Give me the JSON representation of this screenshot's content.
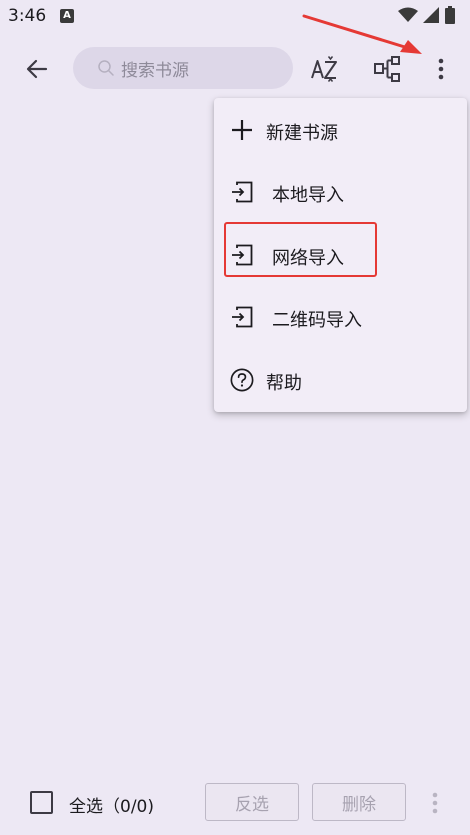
{
  "status_bar": {
    "time": "3:46",
    "notification_badge": "A"
  },
  "toolbar": {
    "search_placeholder": "搜索书源",
    "icons": [
      "back-arrow-icon",
      "sort-az-icon",
      "group-icon",
      "more-vert-icon"
    ]
  },
  "menu": {
    "items": [
      {
        "label": "新建书源",
        "icon": "plus-icon"
      },
      {
        "label": "本地导入",
        "icon": "import-icon"
      },
      {
        "label": "网络导入",
        "icon": "import-icon",
        "highlighted": true
      },
      {
        "label": "二维码导入",
        "icon": "import-icon"
      },
      {
        "label": "帮助",
        "icon": "help-icon"
      }
    ]
  },
  "bottom_bar": {
    "select_all_label": "全选（0/0)",
    "invert_label": "反选",
    "delete_label": "删除"
  },
  "colors": {
    "background": "#ede8f4",
    "menu_background": "#f2edf7",
    "annotation_red": "#e53935",
    "text": "#1c1b1f",
    "disabled_text": "#a7a2b0"
  }
}
